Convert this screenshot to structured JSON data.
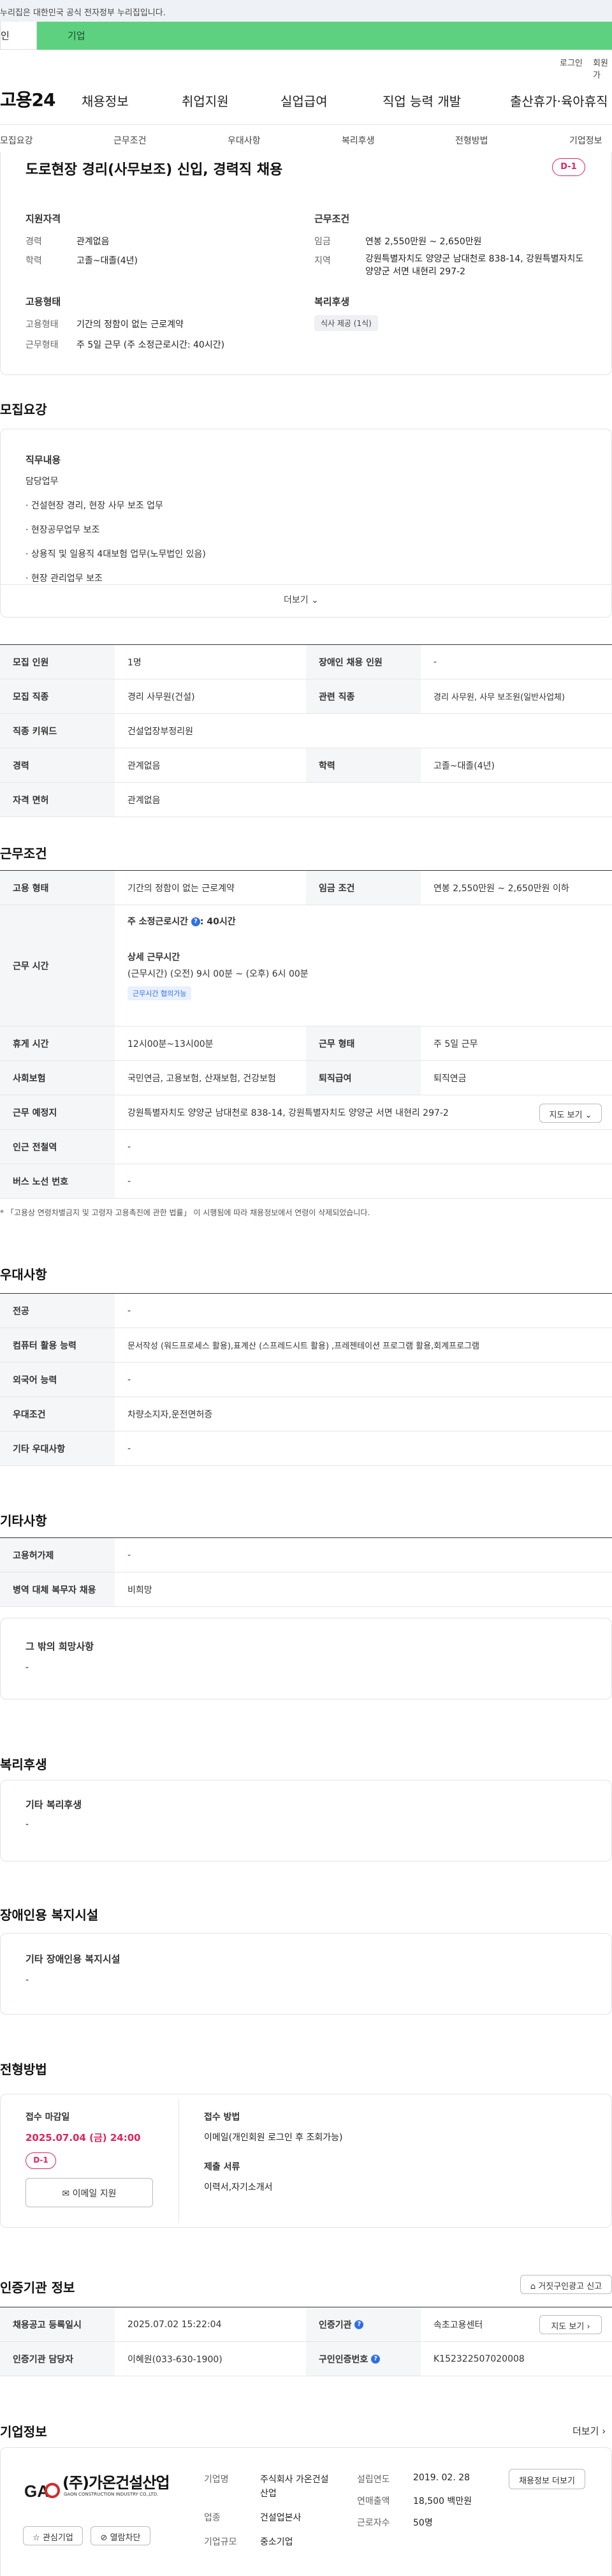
{
  "gov_notice": "누리집은 대한민국 공식 전자정부 누리집입니다.",
  "top_tabs": [
    "인",
    "기업"
  ],
  "util": {
    "login": "로그인",
    "join": "회원가"
  },
  "logo": "고용24",
  "gnb": [
    "채용정보",
    "취업지원",
    "실업급여",
    "직업 능력 개발",
    "출산휴가·육아휴직"
  ],
  "subnav": [
    "모집요강",
    "근무조건",
    "우대사항",
    "복리후생",
    "전형방법",
    "기업정보"
  ],
  "summary": {
    "title": "도로현장 경리(사무보조) 신입, 경력직 채용",
    "dday": "D-1",
    "qual_title": "지원자격",
    "career_label": "경력",
    "career_value": "관계없음",
    "edu_label": "학력",
    "edu_value": "고졸~대졸(4년)",
    "cond_title": "근무조건",
    "wage_label": "임금",
    "wage_value": "연봉 2,550만원 ~ 2,650만원",
    "area_label": "지역",
    "area_value": "강원특별자치도 양양군 남대천로 838-14, 강원특별자치도 양양군 서면 내현리 297-2",
    "emp_title": "고용형태",
    "emp_label": "고용형태",
    "emp_value": "기간의 정함이 없는 근로계약",
    "work_label": "근무형태",
    "work_value": "주 5일 근무 (주 소정근로시간: 40시간)",
    "welfare_title": "복리후생",
    "welfare_chip": "식사 제공 (1식)"
  },
  "recruit": {
    "title": "모집요강",
    "job_title": "직무내용",
    "lines": [
      "담당업무",
      "· 건설현장 경리, 현장 사무 보조 업무",
      "· 현장공무업무 보조",
      "· 상용직 및 일용직 4대보험 업무(노무법인 있음)",
      "· 현장 관리업무 보조"
    ],
    "more": "더보기",
    "rows": [
      {
        "k1": "모집 인원",
        "v1": "1명",
        "k2": "장애인 채용 인원",
        "v2": "-"
      },
      {
        "k1": "모집 직종",
        "v1": "경리 사무원(건설)",
        "k2": "관련 직종",
        "v2": "경리 사무원, 사무 보조원(일반사업체)"
      },
      {
        "k1": "직종 키워드",
        "v1": "건설업장부정리원"
      },
      {
        "k1": "경력",
        "v1": "관계없음",
        "k2": "학력",
        "v2": "고졸~대졸(4년)"
      },
      {
        "k1": "자격 면허",
        "v1": "관계없음"
      }
    ]
  },
  "conditions": {
    "title": "근무조건",
    "emp_k": "고용 형태",
    "emp_v": "기간의 정함이 없는 근로계약",
    "wage_k": "임금 조건",
    "wage_v": "연봉 2,550만원 ~ 2,650만원 이하",
    "time_k": "근무 시간",
    "time_total": "주 소정근로시간",
    "time_total_v": ": 40시간",
    "time_detail_title": "상세 근무시간",
    "time_detail": "(근무시간) (오전) 9시 00분 ~ (오후) 6시 00분",
    "time_chip": "근무시간 협의가능",
    "rest_k": "휴게 시간",
    "rest_v": "12시00분~13시00분",
    "wtype_k": "근무 형태",
    "wtype_v": "주 5일 근무",
    "ins_k": "사회보험",
    "ins_v": "국민연금, 고용보험, 산재보험, 건강보험",
    "ret_k": "퇴직급여",
    "ret_v": "퇴직연금",
    "place_k": "근무 예정지",
    "place_v": "강원특별자치도 양양군 남대천로 838-14, 강원특별자치도 양양군 서면 내현리 297-2",
    "map_btn": "지도 보기",
    "station_k": "인근 전철역",
    "station_v": "-",
    "bus_k": "버스 노선 번호",
    "bus_v": "-",
    "note": "* 「고용상 연령차별금지 및 고령자 고용촉진에 관한 법률」 이 시행됨에 따라 채용정보에서 연령이 삭제되었습니다."
  },
  "preference": {
    "title": "우대사항",
    "rows": [
      {
        "k": "전공",
        "v": "-"
      },
      {
        "k": "컴퓨터 활용 능력",
        "v": "문서작성 (워드프로세스 활용),표계산 (스프레드시트 활용) ,프레젠테이션 프로그램 활용,회계프로그램"
      },
      {
        "k": "외국어 능력",
        "v": "-"
      },
      {
        "k": "우대조건",
        "v": "차량소지자,운전면허증"
      },
      {
        "k": "기타 우대사항",
        "v": "-"
      }
    ]
  },
  "etc": {
    "title": "기타사항",
    "rows": [
      {
        "k": "고용허가제",
        "v": "-"
      },
      {
        "k": "병역 대체 복무자 채용",
        "v": "비희망"
      }
    ],
    "hope_title": "그 밖의 희망사항",
    "hope_value": "-"
  },
  "welfare": {
    "title": "복리후생",
    "box_title": "기타 복리후생",
    "box_value": "-"
  },
  "disabled": {
    "title": "장애인용 복지시설",
    "box_title": "기타 장애인용 복지시설",
    "box_value": "-"
  },
  "process": {
    "title": "전형방법",
    "deadline_title": "접수 마감일",
    "deadline": "2025.07.04 (금) 24:00",
    "dday": "D-1",
    "apply_btn": "이메일 지원",
    "method_title": "접수 방법",
    "method_value": "이메일(개인회원 로그인 후 조회가능)",
    "docs_title": "제출 서류",
    "docs_value": "이력서,자기소개서"
  },
  "agency": {
    "title": "인증기관 정보",
    "report_btn": "거짓구인광고 신고",
    "reg_k": "채용공고 등록일시",
    "reg_v": "2025.07.02 15:22:04",
    "org_k": "인증기관",
    "org_v": "속초고용센터",
    "map_btn": "지도 보기",
    "staff_k": "인증기관 담당자",
    "staff_v": "이혜원(033-630-1900)",
    "no_k": "구인인증번호",
    "no_v": "K152322507020008"
  },
  "company": {
    "title": "기업정보",
    "more": "더보기",
    "logo_text": "(주)가온건설산업",
    "logo_sub": "GAON CONSTRUCTION INDUSTRY CO.,LTD.",
    "name_k": "기업명",
    "name_v": "주식회사 가온건설산업",
    "year_k": "설립연도",
    "year_v": "2019. 02. 28",
    "ind_k": "업종",
    "ind_v": "건설업본사",
    "sales_k": "연매출액",
    "sales_v": "18,500 백만원",
    "size_k": "기업규모",
    "size_v": "중소기업",
    "emp_k": "근로자수",
    "emp_v": "50명",
    "jobs_btn": "채용정보 더보기",
    "fav_btn": "관심기업",
    "block_btn": "열람차단"
  },
  "colors": {
    "accent_green": "#5dd17f",
    "dday_pink": "#e0245e",
    "info_blue": "#2f6fe4"
  }
}
